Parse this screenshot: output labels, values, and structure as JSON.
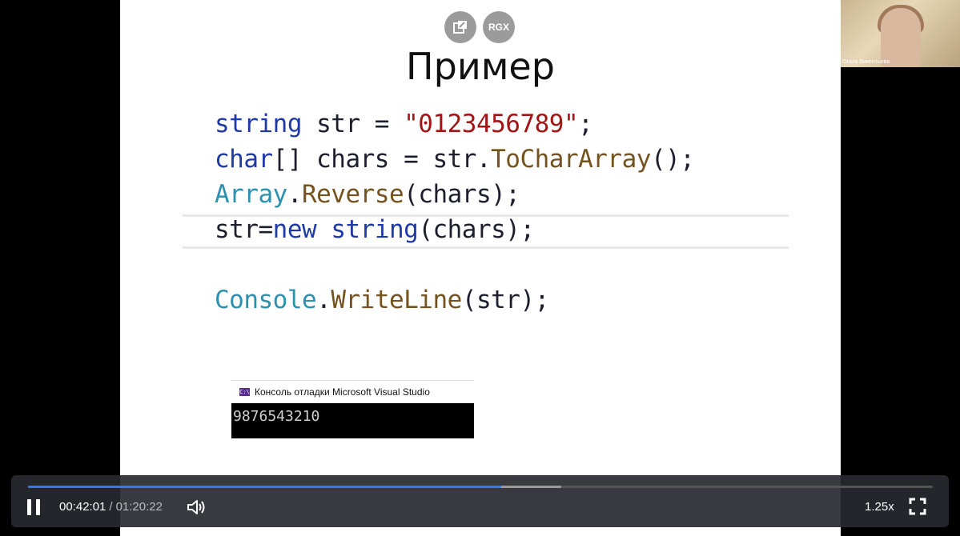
{
  "slide": {
    "title": "Пример",
    "buttons": {
      "pip_icon": "picture-in-picture-icon",
      "rgx_label": "RGX"
    },
    "code": {
      "line1": {
        "kw": "string",
        "mid": " str = ",
        "str": "\"0123456789\"",
        "end": ";"
      },
      "line2": {
        "kw": "char",
        "mid": "[] chars = str.",
        "mth": "ToCharArray",
        "end": "();"
      },
      "line3": {
        "typ": "Array",
        "dot": ".",
        "mth": "Reverse",
        "end": "(chars);"
      },
      "line4": {
        "a": "str=",
        "kw1": "new",
        "sp": " ",
        "kw2": "string",
        "end": "(chars);"
      },
      "line5": {
        "typ": "Console",
        "dot": ".",
        "mth": "WriteLine",
        "end": "(str);"
      }
    },
    "console": {
      "title": "Консоль отладки Microsoft Visual Studio",
      "icon_text": "C:\\",
      "output": "9876543210"
    }
  },
  "webcam": {
    "name": "Ольга Викентьева"
  },
  "player": {
    "current_time": "00:42:01",
    "separator": "/",
    "duration": "01:20:22",
    "speed": "1.25x",
    "progress_played": 0.523,
    "progress_buffered": 0.589,
    "colors": {
      "played": "#2f7bf5",
      "buffered": "#9a9a9a"
    }
  }
}
